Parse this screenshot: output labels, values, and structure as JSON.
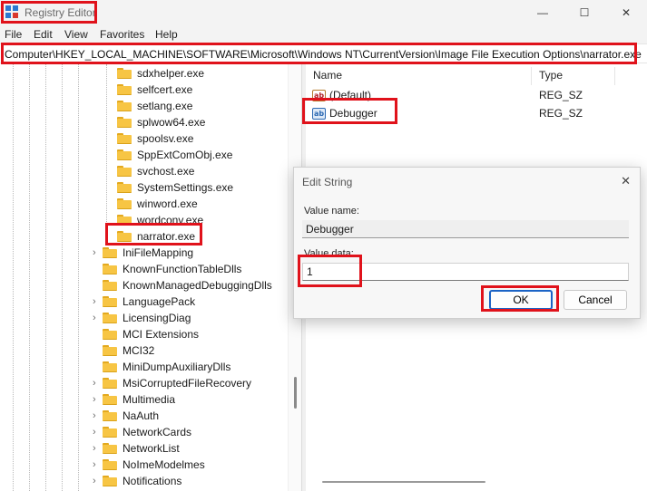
{
  "window": {
    "title": "Registry Editor",
    "controls": {
      "minimize": "—",
      "maximize": "☐",
      "close": "✕"
    }
  },
  "menu": [
    "File",
    "Edit",
    "View",
    "Favorites",
    "Help"
  ],
  "address": "Computer\\HKEY_LOCAL_MACHINE\\SOFTWARE\\Microsoft\\Windows NT\\CurrentVersion\\Image File Execution Options\\narrator.exe",
  "tree": {
    "items": [
      {
        "label": "sdxhelper.exe",
        "expandable": false
      },
      {
        "label": "selfcert.exe",
        "expandable": false
      },
      {
        "label": "setlang.exe",
        "expandable": false
      },
      {
        "label": "splwow64.exe",
        "expandable": false
      },
      {
        "label": "spoolsv.exe",
        "expandable": false
      },
      {
        "label": "SppExtComObj.exe",
        "expandable": false
      },
      {
        "label": "svchost.exe",
        "expandable": false
      },
      {
        "label": "SystemSettings.exe",
        "expandable": false
      },
      {
        "label": "winword.exe",
        "expandable": false
      },
      {
        "label": "wordconv.exe",
        "expandable": false
      },
      {
        "label": "narrator.exe",
        "expandable": false,
        "selected": true
      },
      {
        "label": "IniFileMapping",
        "expandable": true
      },
      {
        "label": "KnownFunctionTableDlls",
        "expandable": false
      },
      {
        "label": "KnownManagedDebuggingDlls",
        "expandable": false
      },
      {
        "label": "LanguagePack",
        "expandable": true
      },
      {
        "label": "LicensingDiag",
        "expandable": true
      },
      {
        "label": "MCI Extensions",
        "expandable": false
      },
      {
        "label": "MCI32",
        "expandable": false
      },
      {
        "label": "MiniDumpAuxiliaryDlls",
        "expandable": false
      },
      {
        "label": "MsiCorruptedFileRecovery",
        "expandable": true
      },
      {
        "label": "Multimedia",
        "expandable": true
      },
      {
        "label": "NaAuth",
        "expandable": true
      },
      {
        "label": "NetworkCards",
        "expandable": true
      },
      {
        "label": "NetworkList",
        "expandable": true
      },
      {
        "label": "NoImeModelmes",
        "expandable": true
      },
      {
        "label": "Notifications",
        "expandable": true
      }
    ]
  },
  "values": {
    "headers": {
      "name": "Name",
      "type": "Type"
    },
    "rows": [
      {
        "icon": "string-value-icon",
        "glyph": "ab",
        "name": "(Default)",
        "type": "REG_SZ"
      },
      {
        "icon": "string-value-icon",
        "glyph": "ab",
        "name": "Debugger",
        "type": "REG_SZ"
      }
    ]
  },
  "dialog": {
    "title": "Edit String",
    "close": "✕",
    "value_name_label": "Value name:",
    "value_name": "Debugger",
    "value_data_label": "Value data:",
    "value_data": "1",
    "ok_label": "OK",
    "cancel_label": "Cancel"
  },
  "colors": {
    "highlight": "#e0121b",
    "folder": "#f7c544",
    "default_button_border": "#1b63c5"
  }
}
